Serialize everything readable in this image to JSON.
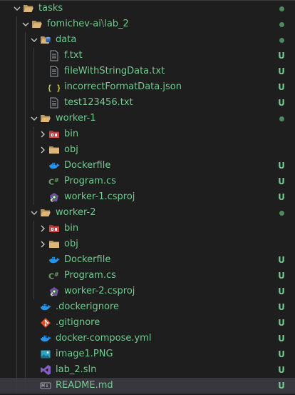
{
  "explorer": {
    "label_color": "#73c991",
    "untracked_badge": "U",
    "items": [
      {
        "label": "tasks",
        "kind": "folder-open",
        "depth": 0,
        "status": "dot"
      },
      {
        "label": "fomichev-ai",
        "label_suffix": "lab_2",
        "kind": "folder-open",
        "depth": 1,
        "status": "dot"
      },
      {
        "label": "data",
        "kind": "folder-data",
        "depth": 2,
        "status": "dot"
      },
      {
        "label": "f.txt",
        "kind": "text-file",
        "depth": 3,
        "status": "U"
      },
      {
        "label": "fileWithStringData.txt",
        "kind": "text-file",
        "depth": 3,
        "status": "U"
      },
      {
        "label": "incorrectFormatData.json",
        "kind": "json-file",
        "depth": 3,
        "status": "U"
      },
      {
        "label": "test123456.txt",
        "kind": "text-file",
        "depth": 3,
        "status": "U"
      },
      {
        "label": "worker-1",
        "kind": "folder-open",
        "depth": 2,
        "status": "dot"
      },
      {
        "label": "bin",
        "kind": "folder-bin",
        "depth": 3,
        "status": ""
      },
      {
        "label": "obj",
        "kind": "folder-closed",
        "depth": 3,
        "status": ""
      },
      {
        "label": "Dockerfile",
        "kind": "docker-file",
        "depth": 3,
        "status": "U"
      },
      {
        "label": "Program.cs",
        "kind": "csharp-file",
        "depth": 3,
        "status": "U"
      },
      {
        "label": "worker-1.csproj",
        "kind": "csproj-file",
        "depth": 3,
        "status": "U"
      },
      {
        "label": "worker-2",
        "kind": "folder-open",
        "depth": 2,
        "status": "dot"
      },
      {
        "label": "bin",
        "kind": "folder-bin",
        "depth": 3,
        "status": ""
      },
      {
        "label": "obj",
        "kind": "folder-closed",
        "depth": 3,
        "status": ""
      },
      {
        "label": "Dockerfile",
        "kind": "docker-file",
        "depth": 3,
        "status": "U"
      },
      {
        "label": "Program.cs",
        "kind": "csharp-file",
        "depth": 3,
        "status": "U"
      },
      {
        "label": "worker-2.csproj",
        "kind": "csproj-file",
        "depth": 3,
        "status": "U"
      },
      {
        "label": ".dockerignore",
        "kind": "docker-file",
        "depth": 2,
        "status": "U"
      },
      {
        "label": ".gitignore",
        "kind": "git-file",
        "depth": 2,
        "status": "U"
      },
      {
        "label": "docker-compose.yml",
        "kind": "docker-file",
        "depth": 2,
        "status": "U"
      },
      {
        "label": "image1.PNG",
        "kind": "image-file",
        "depth": 2,
        "status": "U"
      },
      {
        "label": "lab_2.sln",
        "kind": "vs-file",
        "depth": 2,
        "status": "U"
      },
      {
        "label": "README.md",
        "kind": "markdown-file",
        "depth": 2,
        "status": "U",
        "selected": true
      }
    ]
  }
}
